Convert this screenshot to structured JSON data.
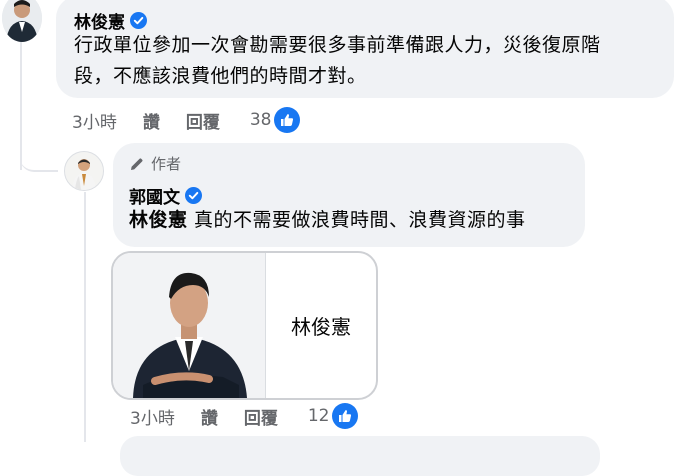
{
  "comment": {
    "author": "林俊憲",
    "text_line1": "行政單位參加一次會勘需要很多事前準備跟人力，災後復原階",
    "text_line2": "段，不應該浪費他們的時間才對。",
    "time": "3小時",
    "like_action": "讚",
    "reply_action": "回覆",
    "like_count": "38"
  },
  "reply": {
    "author_badge": "作者",
    "author": "郭國文",
    "mention": "林俊憲",
    "text": " 真的不需要做浪費時間、浪費資源的事",
    "card_name": "林俊憲",
    "time": "3小時",
    "like_action": "讚",
    "reply_action": "回覆",
    "like_count": "12"
  },
  "colors": {
    "bubble": "#f0f2f5",
    "accent": "#1877f2",
    "meta": "#65676b"
  },
  "icons": {
    "verified": "verified-badge-icon",
    "pencil": "pencil-icon",
    "like": "thumbs-up-icon"
  }
}
